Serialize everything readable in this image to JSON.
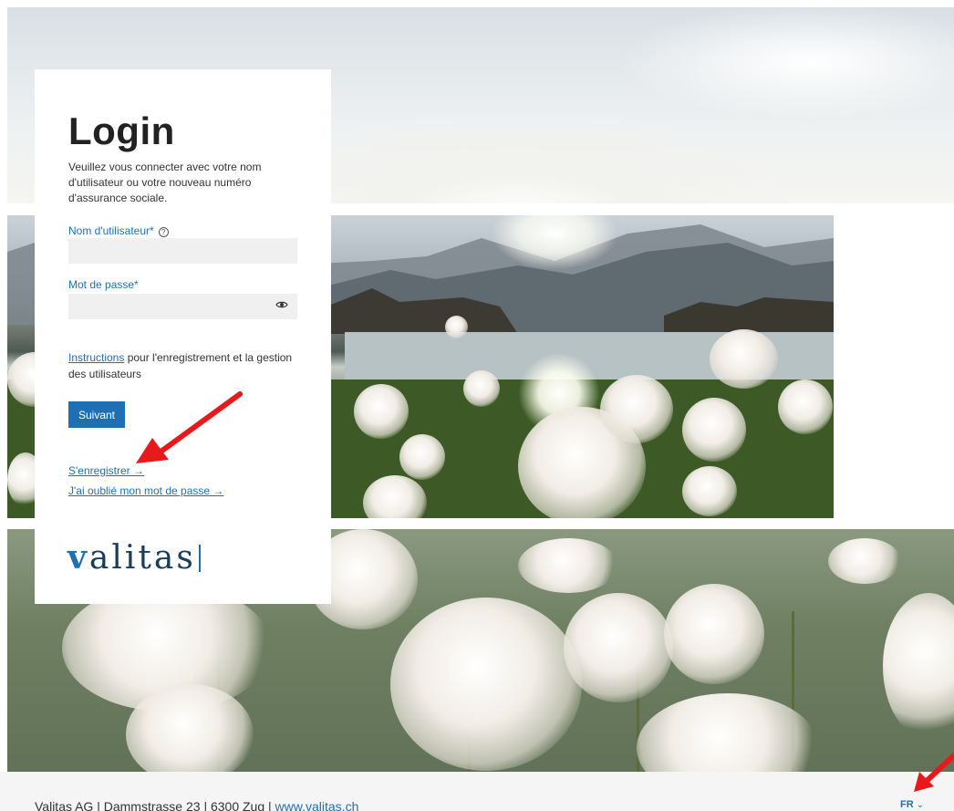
{
  "login": {
    "title": "Login",
    "intro": "Veuillez vous connecter avec votre nom d'utilisateur ou votre nouveau numéro d'assurance sociale.",
    "username_label": "Nom d'utilisateur*",
    "username_value": "",
    "password_label": "Mot de passe*",
    "password_value": "",
    "instructions_link": "Instructions",
    "instructions_rest": " pour l'enregistrement et la gestion des utilisateurs",
    "next_button": "Suivant",
    "register_link": "S'enregistrer →",
    "forgot_link": "J'ai oublié mon mot de passe →"
  },
  "logo": {
    "first_letter": "v",
    "rest": "alitas"
  },
  "footer": {
    "address": "Valitas AG | Dammstrasse 23 | 6300 Zug | ",
    "website": "www.valitas.ch",
    "language": "FR"
  },
  "icons": {
    "help": "question-circle-icon",
    "eye": "eye-icon",
    "chevron": "chevron-down-icon"
  },
  "colors": {
    "accent": "#1f6fb4",
    "annotation_arrow": "#e8191b"
  }
}
